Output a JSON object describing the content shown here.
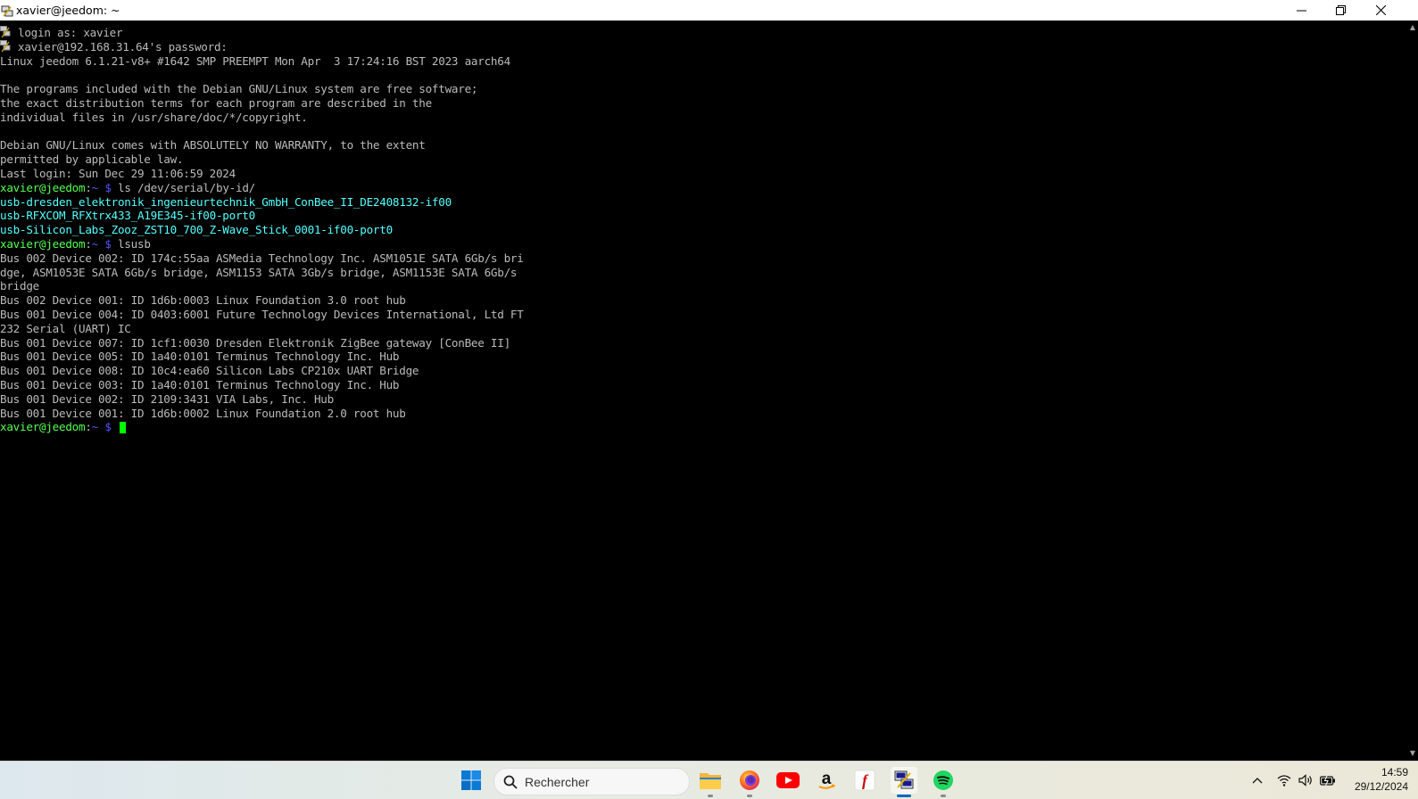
{
  "window": {
    "title": "xavier@jeedom: ~",
    "app_icon": "putty-icon",
    "controls": [
      "minimize-icon",
      "restore-icon",
      "close-icon"
    ]
  },
  "terminal": {
    "colors": {
      "text": "#bbbbbb",
      "prompt": "#54ff54",
      "path": "#5454ff",
      "link": "#54ffff",
      "cursor": "#00ff00",
      "background": "#000000"
    },
    "lines": [
      {
        "icon": true,
        "segments": [
          {
            "text": "login as: xavier",
            "color": "gray"
          }
        ]
      },
      {
        "icon": true,
        "segments": [
          {
            "text": "xavier@192.168.31.64's password:",
            "color": "gray"
          }
        ]
      },
      {
        "segments": [
          {
            "text": "Linux jeedom 6.1.21-v8+ #1642 SMP PREEMPT Mon Apr  3 17:24:16 BST 2023 aarch64",
            "color": "gray"
          }
        ]
      },
      {
        "segments": []
      },
      {
        "segments": [
          {
            "text": "The programs included with the Debian GNU/Linux system are free software;",
            "color": "gray"
          }
        ]
      },
      {
        "segments": [
          {
            "text": "the exact distribution terms for each program are described in the",
            "color": "gray"
          }
        ]
      },
      {
        "segments": [
          {
            "text": "individual files in /usr/share/doc/*/copyright.",
            "color": "gray"
          }
        ]
      },
      {
        "segments": []
      },
      {
        "segments": [
          {
            "text": "Debian GNU/Linux comes with ABSOLUTELY NO WARRANTY, to the extent",
            "color": "gray"
          }
        ]
      },
      {
        "segments": [
          {
            "text": "permitted by applicable law.",
            "color": "gray"
          }
        ]
      },
      {
        "segments": [
          {
            "text": "Last login: Sun Dec 29 11:06:59 2024",
            "color": "gray"
          }
        ]
      },
      {
        "segments": [
          {
            "text": "xavier@jeedom",
            "color": "green"
          },
          {
            "text": ":",
            "color": "gray"
          },
          {
            "text": "~ $",
            "color": "blue"
          },
          {
            "text": " ls /dev/serial/by-id/",
            "color": "gray"
          }
        ]
      },
      {
        "segments": [
          {
            "text": "usb-dresden_elektronik_ingenieurtechnik_GmbH_ConBee_II_DE2408132-if00",
            "color": "cyan"
          }
        ]
      },
      {
        "segments": [
          {
            "text": "usb-RFXCOM_RFXtrx433_A19E345-if00-port0",
            "color": "cyan"
          }
        ]
      },
      {
        "segments": [
          {
            "text": "usb-Silicon_Labs_Zooz_ZST10_700_Z-Wave_Stick_0001-if00-port0",
            "color": "cyan"
          }
        ]
      },
      {
        "segments": [
          {
            "text": "xavier@jeedom",
            "color": "green"
          },
          {
            "text": ":",
            "color": "gray"
          },
          {
            "text": "~ $",
            "color": "blue"
          },
          {
            "text": " lsusb",
            "color": "gray"
          }
        ]
      },
      {
        "segments": [
          {
            "text": "Bus 002 Device 002: ID 174c:55aa ASMedia Technology Inc. ASM1051E SATA 6Gb/s bri",
            "color": "gray"
          }
        ]
      },
      {
        "segments": [
          {
            "text": "dge, ASM1053E SATA 6Gb/s bridge, ASM1153 SATA 3Gb/s bridge, ASM1153E SATA 6Gb/s",
            "color": "gray"
          }
        ]
      },
      {
        "segments": [
          {
            "text": "bridge",
            "color": "gray"
          }
        ]
      },
      {
        "segments": [
          {
            "text": "Bus 002 Device 001: ID 1d6b:0003 Linux Foundation 3.0 root hub",
            "color": "gray"
          }
        ]
      },
      {
        "segments": [
          {
            "text": "Bus 001 Device 004: ID 0403:6001 Future Technology Devices International, Ltd FT",
            "color": "gray"
          }
        ]
      },
      {
        "segments": [
          {
            "text": "232 Serial (UART) IC",
            "color": "gray"
          }
        ]
      },
      {
        "segments": [
          {
            "text": "Bus 001 Device 007: ID 1cf1:0030 Dresden Elektronik ZigBee gateway [ConBee II]",
            "color": "gray"
          }
        ]
      },
      {
        "segments": [
          {
            "text": "Bus 001 Device 005: ID 1a40:0101 Terminus Technology Inc. Hub",
            "color": "gray"
          }
        ]
      },
      {
        "segments": [
          {
            "text": "Bus 001 Device 008: ID 10c4:ea60 Silicon Labs CP210x UART Bridge",
            "color": "gray"
          }
        ]
      },
      {
        "segments": [
          {
            "text": "Bus 001 Device 003: ID 1a40:0101 Terminus Technology Inc. Hub",
            "color": "gray"
          }
        ]
      },
      {
        "segments": [
          {
            "text": "Bus 001 Device 002: ID 2109:3431 VIA Labs, Inc. Hub",
            "color": "gray"
          }
        ]
      },
      {
        "segments": [
          {
            "text": "Bus 001 Device 001: ID 1d6b:0002 Linux Foundation 2.0 root hub",
            "color": "gray"
          }
        ]
      },
      {
        "segments": [
          {
            "text": "xavier@jeedom",
            "color": "green"
          },
          {
            "text": ":",
            "color": "gray"
          },
          {
            "text": "~ $",
            "color": "blue"
          },
          {
            "text": " ",
            "color": "gray"
          }
        ],
        "cursor": true
      }
    ]
  },
  "taskbar": {
    "search": {
      "placeholder": "Rechercher",
      "icon": "search-icon"
    },
    "apps": [
      {
        "name": "windows-start-icon",
        "running": false
      },
      {
        "name": "file-explorer-icon",
        "running": true
      },
      {
        "name": "firefox-icon",
        "running": true
      },
      {
        "name": "youtube-icon",
        "running": false
      },
      {
        "name": "amazon-icon",
        "running": false
      },
      {
        "name": "flash-icon",
        "running": false
      },
      {
        "name": "putty-icon",
        "running": true,
        "active": true
      },
      {
        "name": "spotify-icon",
        "running": true
      }
    ],
    "tray": [
      "chevron-up-icon",
      "wifi-icon",
      "speaker-icon",
      "battery-icon"
    ],
    "clock": {
      "time": "14:59",
      "date": "29/12/2024"
    }
  }
}
